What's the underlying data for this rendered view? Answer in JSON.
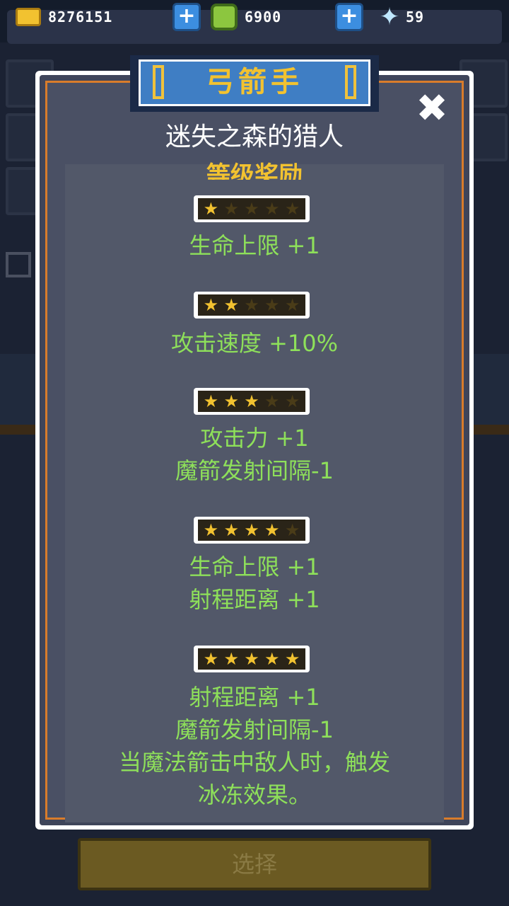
{
  "resources": {
    "coins": "8276151",
    "gems": "6900",
    "crystals": "59",
    "plus_label": "+"
  },
  "modal": {
    "title": "弓箭手",
    "subtitle": "迷失之森的猎人",
    "section_header": "等级奖励",
    "close_label": "✖",
    "levels": [
      {
        "stars": 1,
        "rewards": [
          "生命上限 +1"
        ]
      },
      {
        "stars": 2,
        "rewards": [
          "攻击速度 +10%"
        ]
      },
      {
        "stars": 3,
        "rewards": [
          "攻击力 +1",
          "魔箭发射间隔-1"
        ]
      },
      {
        "stars": 4,
        "rewards": [
          "生命上限 +1",
          "射程距离 +1"
        ]
      },
      {
        "stars": 5,
        "rewards": [
          "射程距离 +1",
          "魔箭发射间隔-1",
          "当魔法箭击中敌人时，触发",
          "冰冻效果。"
        ]
      }
    ],
    "max_stars": 5
  },
  "select_button": {
    "label": "选择"
  },
  "colors": {
    "title_gold": "#f2c230",
    "reward_green": "#8ee05a",
    "frame_orange": "#d97c2b",
    "banner_blue": "#3f7ec4"
  }
}
